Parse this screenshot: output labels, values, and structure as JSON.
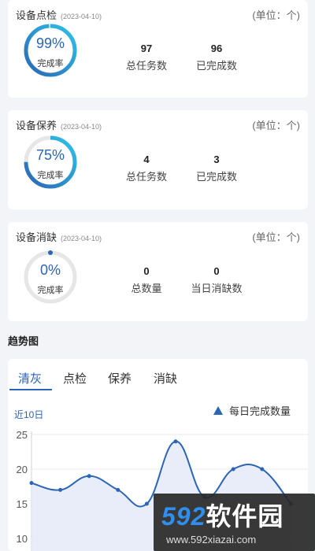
{
  "cards": [
    {
      "title": "设备点检",
      "date": "(2023-04-10)",
      "unit": "(单位：个)",
      "percent_text": "99%",
      "percent": 99,
      "rate_label": "完成率",
      "stat1_value": "97",
      "stat1_label": "总任务数",
      "stat2_value": "96",
      "stat2_label": "已完成数"
    },
    {
      "title": "设备保养",
      "date": "(2023-04-10)",
      "unit": "(单位：个)",
      "percent_text": "75%",
      "percent": 75,
      "rate_label": "完成率",
      "stat1_value": "4",
      "stat1_label": "总任务数",
      "stat2_value": "3",
      "stat2_label": "已完成数"
    },
    {
      "title": "设备消缺",
      "date": "(2023-04-10)",
      "unit": "(单位：个)",
      "percent_text": "0%",
      "percent": 0,
      "rate_label": "完成率",
      "stat1_value": "0",
      "stat1_label": "总数量",
      "stat2_value": "0",
      "stat2_label": "当日消缺数"
    }
  ],
  "trend": {
    "title": "趋势图",
    "tabs": [
      "清灰",
      "点检",
      "保养",
      "消缺"
    ],
    "active_tab": 0,
    "period_label": "近10日",
    "legend_label": "每日完成数量"
  },
  "colors": {
    "accent": "#2b65b5",
    "ring_start": "#2b65b5",
    "ring_end": "#2ec4e8",
    "ring_track": "#e6e6e6",
    "line": "#2b65b5",
    "area": "#e4eaf8"
  },
  "chart_data": {
    "type": "area",
    "series": [
      {
        "name": "每日完成数量",
        "values": [
          18,
          17,
          19,
          17,
          15,
          24,
          16,
          20,
          20,
          15
        ]
      }
    ],
    "y_ticks": [
      "25",
      "20",
      "15",
      "10"
    ],
    "ylim": [
      10,
      25
    ],
    "grid": true,
    "legend": "top-right"
  },
  "watermark": {
    "logo_number": "592",
    "logo_text": "软件园",
    "url": "www.592xiazai.com"
  }
}
